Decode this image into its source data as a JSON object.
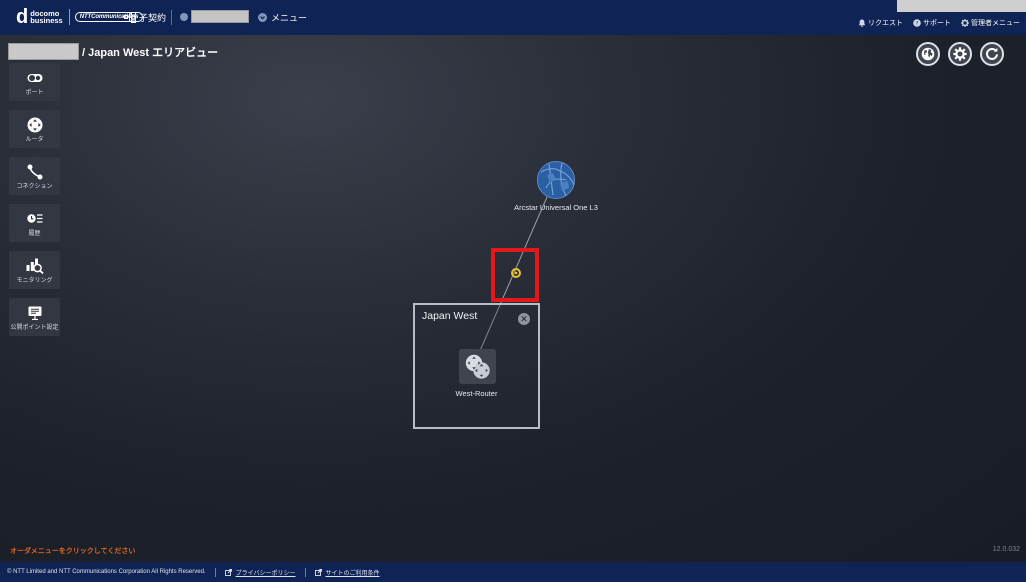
{
  "header": {
    "brand": {
      "mark": "d",
      "line1": "docomo",
      "line2": "business",
      "partner": "NTTCommunications"
    },
    "sub_contract_label": "子契約",
    "menu_label": "メニュー",
    "right_links": [
      {
        "label": "リクエスト",
        "icon": "bell-icon"
      },
      {
        "label": "サポート",
        "icon": "help-icon"
      },
      {
        "label": "管理者メニュー",
        "icon": "gear-icon"
      }
    ]
  },
  "breadcrumb": {
    "title": "/ Japan West エリアビュー"
  },
  "sidebar": {
    "items": [
      {
        "label": "ポート",
        "icon": "port-icon"
      },
      {
        "label": "ルータ",
        "icon": "router-icon"
      },
      {
        "label": "コネクション",
        "icon": "connection-icon"
      },
      {
        "label": "履歴",
        "icon": "history-icon"
      },
      {
        "label": "モニタリング",
        "icon": "monitoring-icon"
      },
      {
        "label": "公開ポイント設定",
        "icon": "public-point-icon"
      }
    ]
  },
  "topology": {
    "cloud": {
      "label": "Arcstar Universal One L3"
    },
    "area": {
      "title": "Japan West",
      "router_label": "West-Router"
    },
    "connector_color": "#e8c12d",
    "highlight_color": "#e11919"
  },
  "hint": "オーダメニューをクリックしてください",
  "version": "12.0.032",
  "footer": {
    "copyright": "© NTT Limited and NTT Communications Corporation All Rights Reserved.",
    "privacy": "プライバシーポリシー",
    "terms": "サイトのご利用条件"
  },
  "colors": {
    "header_bg": "#0f2454",
    "accent_orange": "#e0641f"
  }
}
